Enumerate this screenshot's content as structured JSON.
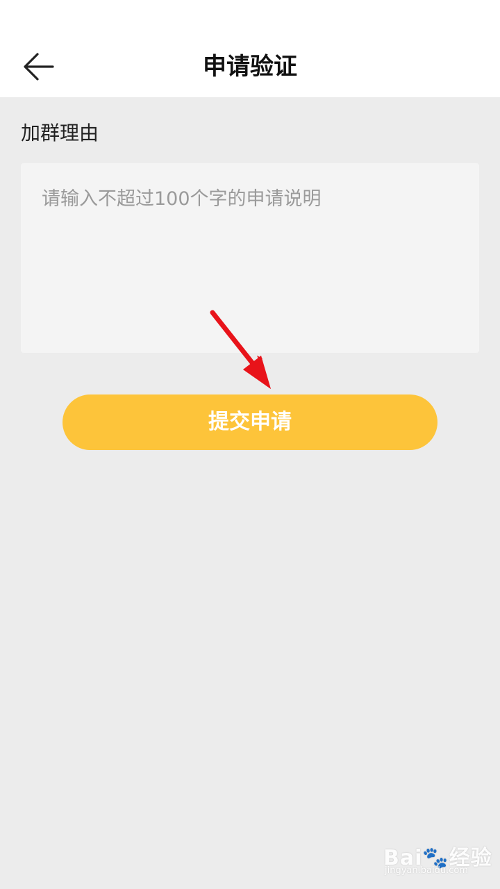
{
  "header": {
    "title": "申请验证",
    "back_icon": "arrow-left-icon"
  },
  "form": {
    "label": "加群理由",
    "reason_placeholder": "请输入不超过100个字的申请说明",
    "reason_value": ""
  },
  "actions": {
    "submit_label": "提交申请"
  },
  "annotation": {
    "arrow_icon": "red-arrow-icon",
    "arrow_color": "#e8131a"
  },
  "watermark": {
    "main": "Bai🐾经验",
    "sub": "jingyan.baidu.com"
  },
  "colors": {
    "accent": "#fdc43a",
    "background": "#ececec",
    "header_bg": "#ffffff",
    "input_bg": "#f4f4f4"
  }
}
